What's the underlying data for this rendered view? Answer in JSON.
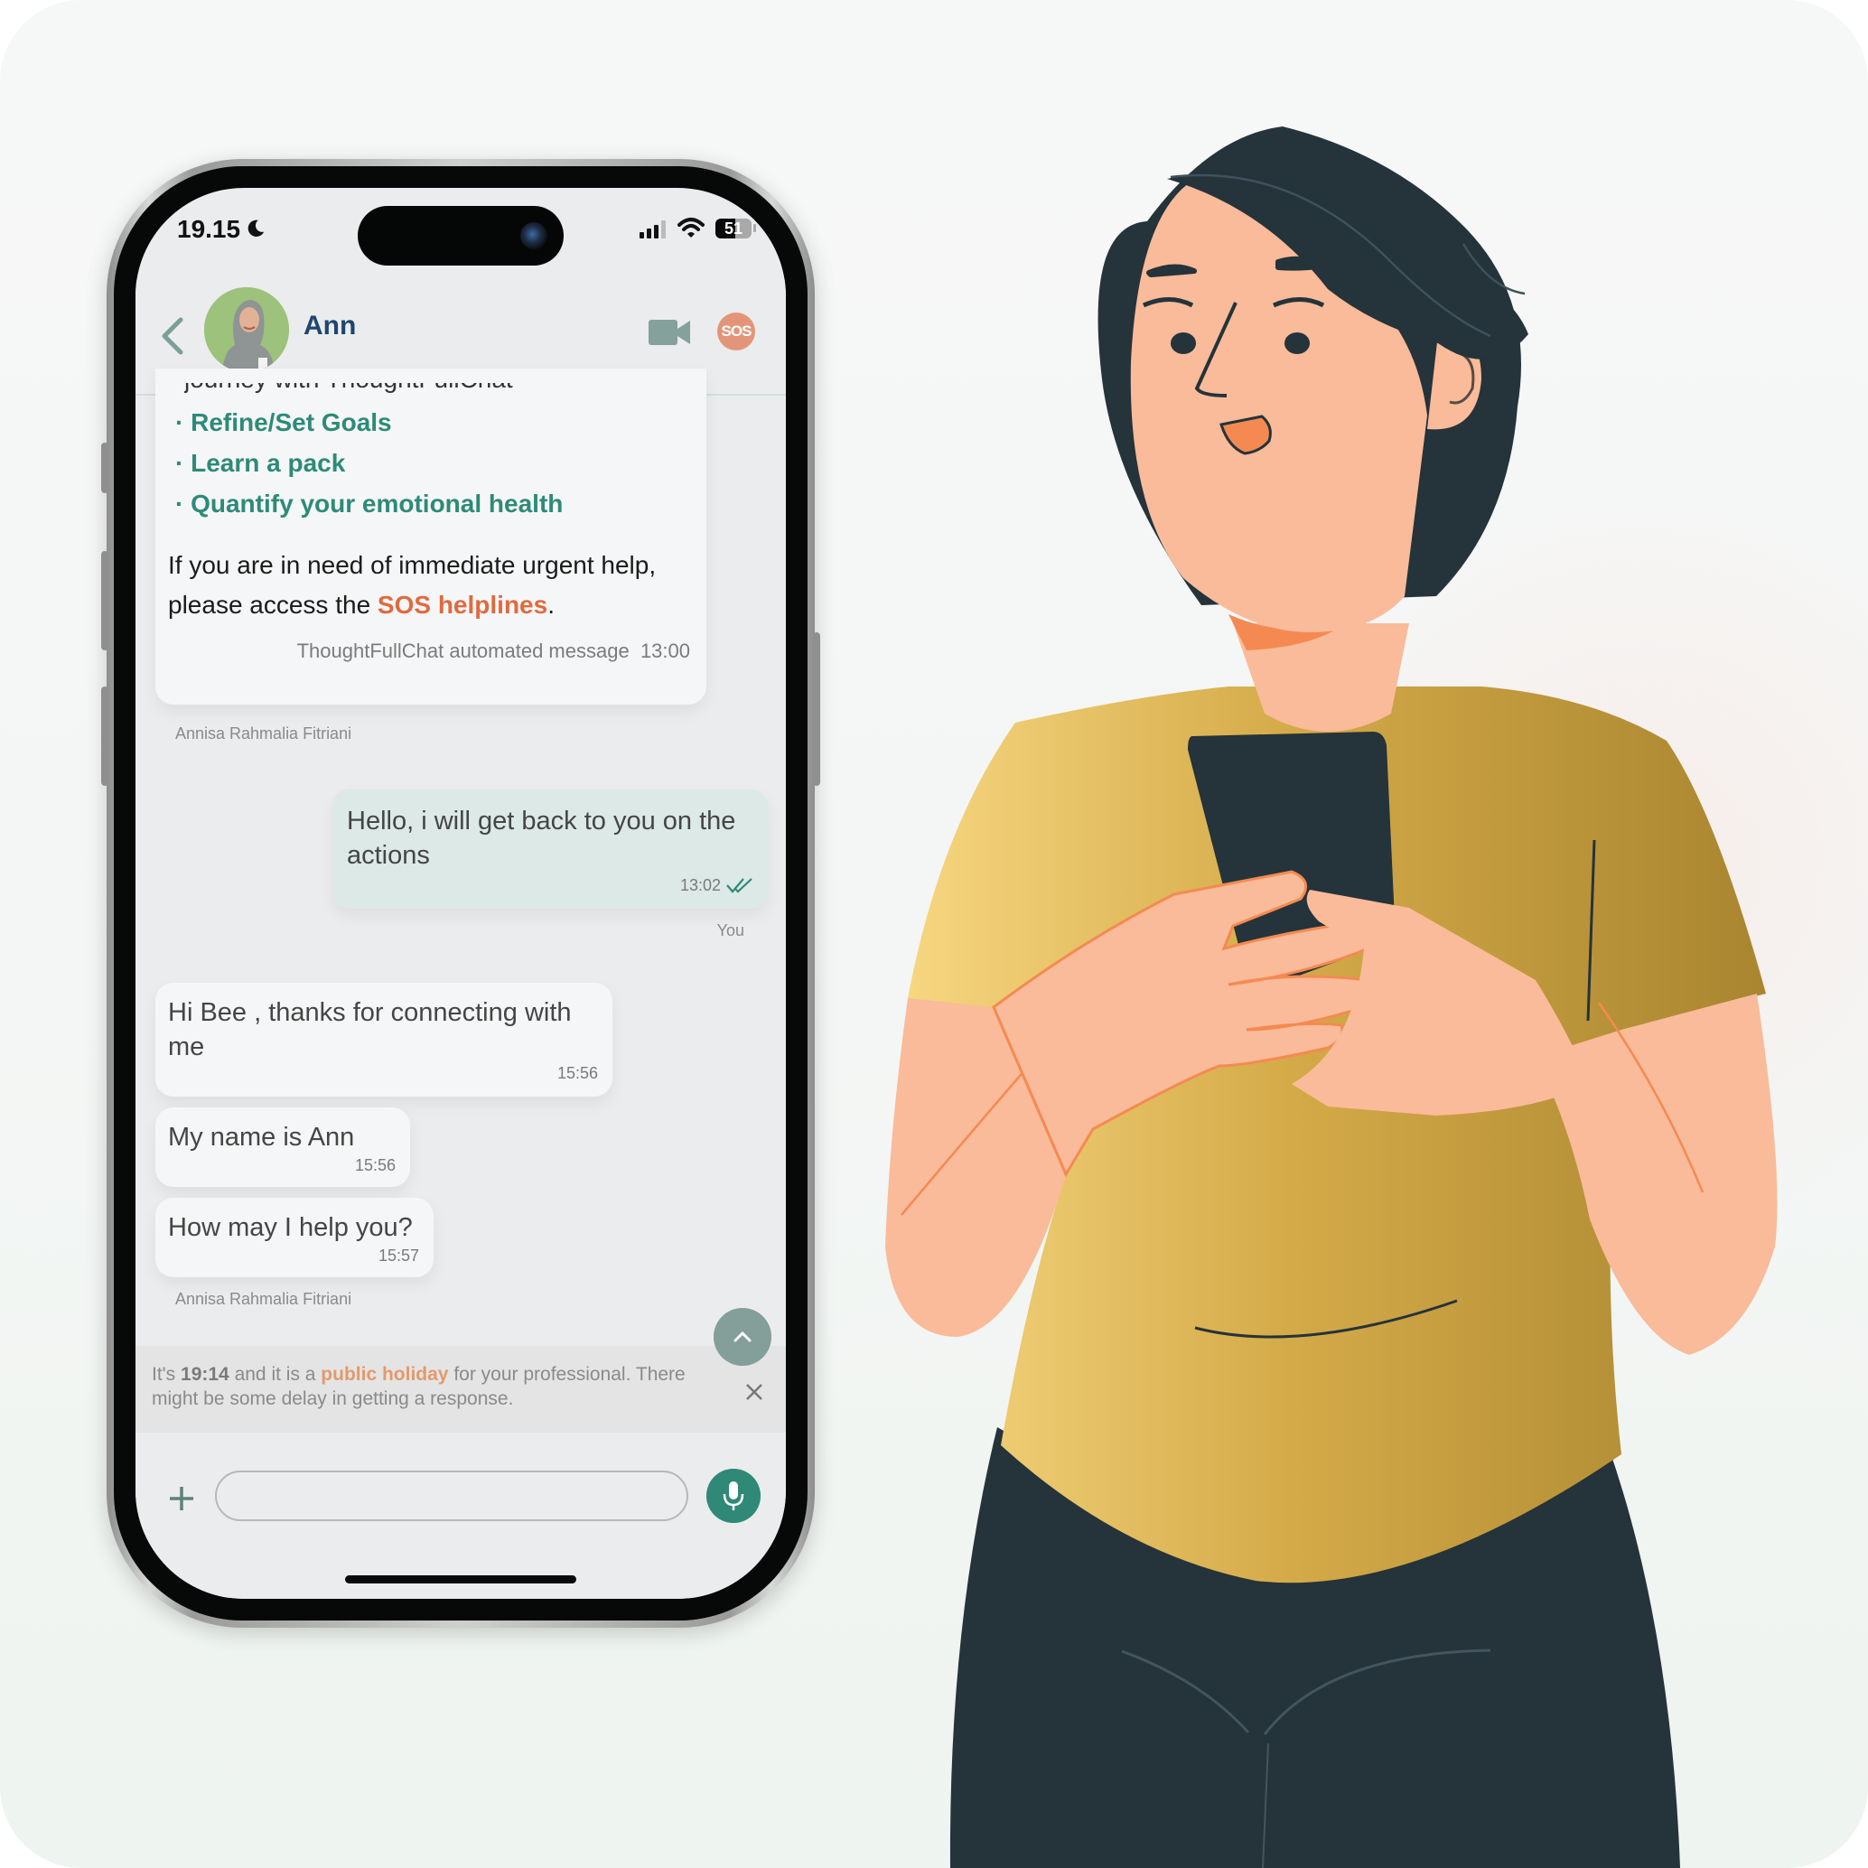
{
  "status_bar": {
    "time": "19.15",
    "battery": "51"
  },
  "header": {
    "contact_name": "Ann",
    "sos_label": "SOS"
  },
  "messages": {
    "automated": {
      "clipped_line": "journey with ThoughtFullChat",
      "goals": [
        "· Refine/Set Goals",
        "· Learn a pack",
        "· Quantify your emotional health"
      ],
      "help_prefix": "If you are in need of immediate urgent help, please access the ",
      "help_link": "SOS helplines",
      "help_suffix": ".",
      "footer": "ThoughtFullChat automated message",
      "time": "13:00"
    },
    "sender_name_1": "Annisa Rahmalia Fitriani",
    "outgoing": {
      "text": "Hello, i will get back to you on the actions",
      "time": "13:02",
      "sender": "You"
    },
    "incoming": [
      {
        "text": "Hi Bee , thanks for connecting with me",
        "time": "15:56"
      },
      {
        "text": "My name is Ann",
        "time": "15:56"
      },
      {
        "text": "How may I help you?",
        "time": "15:57"
      }
    ],
    "sender_name_2": "Annisa Rahmalia Fitriani"
  },
  "notice": {
    "prefix": "It's ",
    "time": "19:14",
    "middle": " and it is a ",
    "highlight": "public holiday",
    "suffix": " for your professional. There might be some delay in getting a response."
  },
  "composer": {
    "value": "",
    "placeholder": ""
  },
  "colors": {
    "accent_green": "#2f8976",
    "sos_orange": "#e06a3f",
    "name_blue": "#1f4670",
    "shirt_gold": "#c9a13e",
    "dark_navy": "#25333a",
    "skin": "#f9bb99"
  }
}
